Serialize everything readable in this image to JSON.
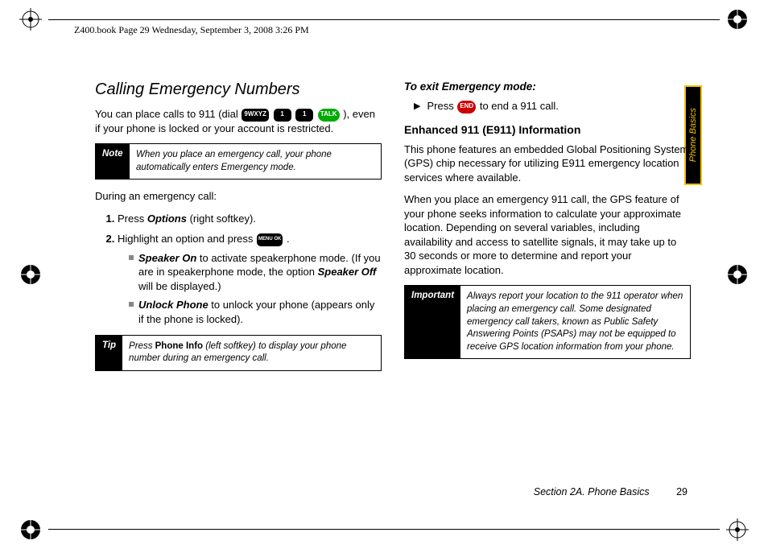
{
  "header": "Z400.book  Page 29  Wednesday, September 3, 2008  3:26 PM",
  "sideTab": "Phone Basics",
  "footer": {
    "section": "Section 2A. Phone Basics",
    "page": "29"
  },
  "left": {
    "title": "Calling Emergency Numbers",
    "intro_a": "You can place calls to 911 (dial ",
    "intro_b": "), even if your phone is locked or your account is restricted.",
    "note": {
      "label": "Note",
      "body": "When you place an emergency call, your phone automatically enters Emergency mode."
    },
    "during": "During an emergency call:",
    "step1_a": "Press ",
    "step1_opt": "Options",
    "step1_b": " (right softkey).",
    "step2_a": "Highlight an option and press ",
    "step2_b": ".",
    "menuKey": "MENU OK",
    "sub1_label": "Speaker On",
    "sub1_text": " to activate speakerphone mode. (If you are in speakerphone mode, the option ",
    "sub1_off": "Speaker Off",
    "sub1_end": " will be displayed.)",
    "sub2_label": "Unlock Phone",
    "sub2_text": " to unlock your phone (appears only if the phone is locked).",
    "tip": {
      "label": "Tip",
      "body_a": "Press ",
      "body_bold": "Phone Info",
      "body_b": " (left softkey) to display your phone number during an emergency call."
    }
  },
  "right": {
    "exitHead": "To exit Emergency mode:",
    "exit_a": "Press ",
    "exit_b": " to end a 911 call.",
    "endKey": "END",
    "e911Head": "Enhanced 911 (E911) Information",
    "e911p1": "This phone features an embedded Global Positioning System (GPS) chip necessary for utilizing E911 emergency location services where available.",
    "e911p2": "When you place an emergency 911 call, the GPS feature of your phone seeks information to calculate your approximate location. Depending on several variables, including availability and access to satellite signals, it may take up to 30 seconds or more to determine and report your approximate location.",
    "important": {
      "label": "Important",
      "body": "Always report your location to the 911 operator when placing an emergency call. Some designated emergency call takers, known as Public Safety Answering Points (PSAPs) may not be equipped to receive GPS location information from your phone."
    }
  },
  "keys": {
    "nine": "9WXYZ",
    "one": "1",
    "talk": "TALK"
  }
}
